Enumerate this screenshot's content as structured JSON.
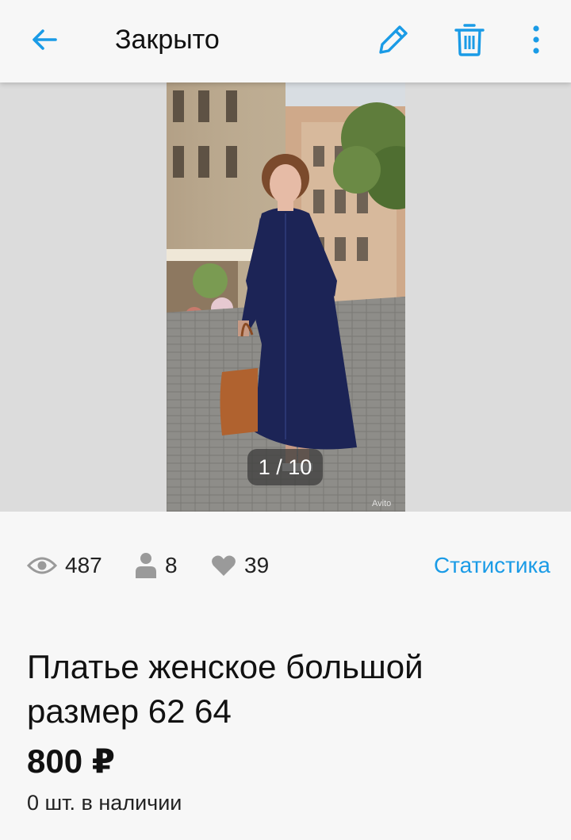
{
  "header": {
    "title": "Закрыто",
    "back_icon": "arrow-left-icon",
    "edit_icon": "pencil-icon",
    "delete_icon": "trash-icon",
    "more_icon": "more-vertical-icon",
    "accent_color": "#1a9be6"
  },
  "gallery": {
    "counter": "1 / 10",
    "watermark": "Avito",
    "current_index": 1,
    "total": 10
  },
  "stats": {
    "views": "487",
    "contacts": "8",
    "favorites": "39",
    "link_label": "Статистика"
  },
  "listing": {
    "title": "Платье женское большой размер 62 64",
    "price": "800 ₽",
    "stock": "0 шт. в наличии"
  }
}
